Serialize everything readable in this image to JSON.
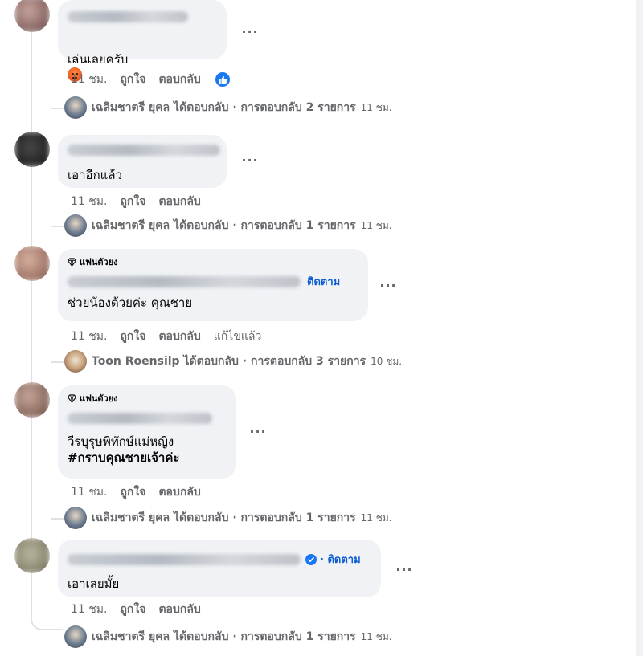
{
  "colors": {
    "bubble": "#f0f2f5",
    "link_blue": "#0a5cd0",
    "meta_gray": "#65676b",
    "like_blue": "#1877f2"
  },
  "actions": {
    "like": "ถูกใจ",
    "reply": "ตอบกลับ",
    "edited": "แก้ไขแล้ว",
    "more": "···"
  },
  "comments": [
    {
      "text": "เล่นเลยครับ",
      "emoji": "angry-face-emoji",
      "time": "11 ชม.",
      "reaction": "like-icon",
      "replies": {
        "author": "เฉลิมชาตรี ยุคล",
        "summary": "ได้ตอบกลับ · การตอบกลับ 2 รายการ",
        "time": "11 ชม."
      }
    },
    {
      "text": "เอาอีกแล้ว",
      "time": "11 ชม.",
      "replies": {
        "author": "เฉลิมชาตรี ยุคล",
        "summary": "ได้ตอบกลับ · การตอบกลับ 1 รายการ",
        "time": "11 ชม."
      }
    },
    {
      "badge": "แฟนตัวยง",
      "follow": "ติดตาม",
      "text": "ช่วยน้องด้วยค่ะ คุณชาย",
      "time": "11 ชม.",
      "edited": true,
      "replies": {
        "author": "Toon Roensilp",
        "summary": "ได้ตอบกลับ · การตอบกลับ 3 รายการ",
        "time": "10 ชม."
      }
    },
    {
      "badge": "แฟนตัวยง",
      "text_line1": "วีรบุรุษพิทักษ์แม่หญิง",
      "hashtag": "#กราบคุณชายเจ้าค่ะ",
      "time": "11 ชม.",
      "replies": {
        "author": "เฉลิมชาตรี ยุคล",
        "summary": "ได้ตอบกลับ · การตอบกลับ 1 รายการ",
        "time": "11 ชม."
      }
    },
    {
      "verified": true,
      "follow": "· ติดตาม",
      "text": "เอาเลยมั้ย",
      "time": "11 ชม.",
      "replies": {
        "author": "เฉลิมชาตรี ยุคล",
        "summary": "ได้ตอบกลับ · การตอบกลับ 1 รายการ",
        "time": "11 ชม."
      }
    }
  ]
}
